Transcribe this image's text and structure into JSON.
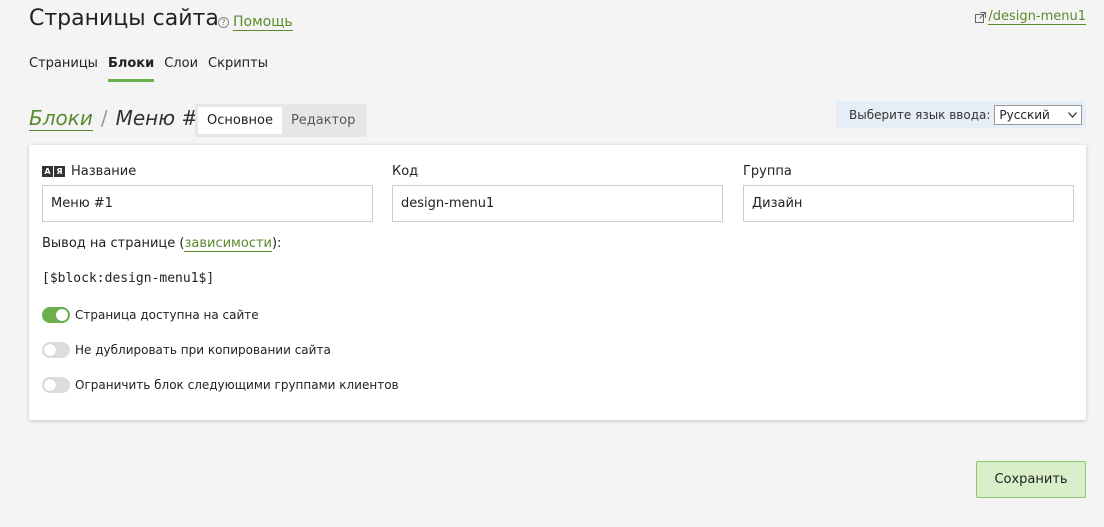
{
  "header": {
    "title": "Страницы сайта",
    "help_label": "Помощь",
    "external_link": "/design-menu1"
  },
  "main_tabs": [
    {
      "label": "Страницы",
      "active": false
    },
    {
      "label": "Блоки",
      "active": true
    },
    {
      "label": "Слои",
      "active": false
    },
    {
      "label": "Скрипты",
      "active": false
    }
  ],
  "breadcrumb": {
    "parent": "Блоки",
    "separator": "/",
    "current": "Меню #1"
  },
  "sub_tabs": [
    {
      "label": "Основное",
      "active": true
    },
    {
      "label": "Редактор",
      "active": false
    }
  ],
  "language": {
    "label": "Выберите язык ввода:",
    "selected": "Русский"
  },
  "form": {
    "name_label": "Название",
    "name_value": "Меню #1",
    "code_label": "Код",
    "code_value": "design-menu1",
    "group_label": "Группа",
    "group_value": "Дизайн",
    "output_prefix": "Вывод на странице (",
    "output_link": "зависимости",
    "output_suffix": "):",
    "code_snippet": "[$block:design-menu1$]",
    "toggles": [
      {
        "label": "Страница доступна на сайте",
        "on": true
      },
      {
        "label": "Не дублировать при копировании сайта",
        "on": false
      },
      {
        "label": "Ограничить блок следующими группами клиентов",
        "on": false
      }
    ]
  },
  "actions": {
    "save_label": "Сохранить"
  },
  "colors": {
    "accent": "#6ab04c",
    "link": "#5a8a2e",
    "save_bg": "#d8efc9",
    "lang_bg": "#e5eef6"
  }
}
